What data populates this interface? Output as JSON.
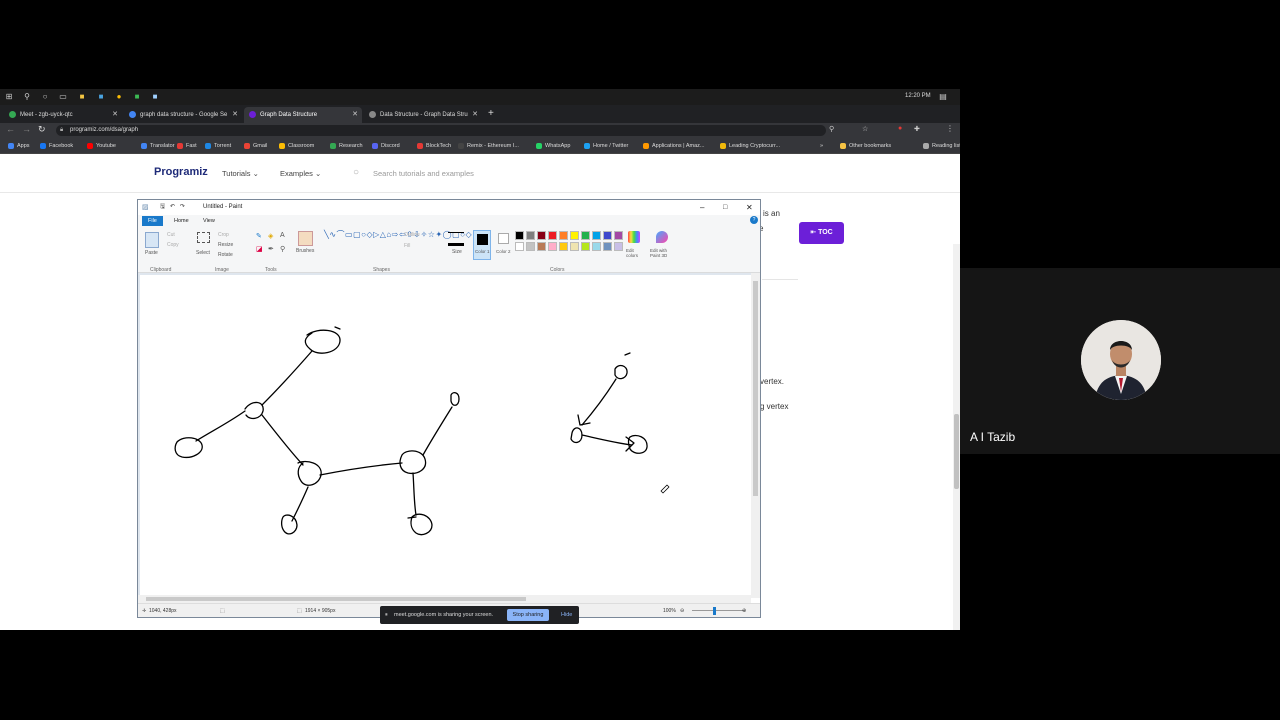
{
  "taskbar": {
    "time": "12:20 PM"
  },
  "tabs": [
    {
      "title": "Meet - zgb-uyck-qtc",
      "favicon": "#34a853"
    },
    {
      "title": "graph data structure - Google Se",
      "favicon": "#4285f4"
    },
    {
      "title": "Graph Data Structure",
      "favicon": "#6c1fd8"
    },
    {
      "title": "Data Structure - Graph Data Stru",
      "favicon": "#888888"
    }
  ],
  "address": {
    "url": "programiz.com/dsa/graph"
  },
  "bookmarks": [
    {
      "label": "Apps",
      "color": "#4285f4"
    },
    {
      "label": "Facebook",
      "color": "#1877f2"
    },
    {
      "label": "Youtube",
      "color": "#ff0000"
    },
    {
      "label": "Translator",
      "color": "#4285f4"
    },
    {
      "label": "Fast",
      "color": "#e53935"
    },
    {
      "label": "Torrent",
      "color": "#1e88e5"
    },
    {
      "label": "Gmail",
      "color": "#ea4335"
    },
    {
      "label": "Classroom",
      "color": "#fbbc04"
    },
    {
      "label": "Research",
      "color": "#34a853"
    },
    {
      "label": "Discord",
      "color": "#5865f2"
    },
    {
      "label": "BlockTech",
      "color": "#e53935"
    },
    {
      "label": "Remix - Ethereum I...",
      "color": "#444444"
    },
    {
      "label": "WhatsApp",
      "color": "#25d366"
    },
    {
      "label": "Home / Twitter",
      "color": "#1da1f2"
    },
    {
      "label": "Applications | Amaz...",
      "color": "#ff9900"
    },
    {
      "label": "Leading Cryptocurr...",
      "color": "#f0b90b"
    },
    {
      "label": "Other bookmarks",
      "color": "#f6c344"
    },
    {
      "label": "Reading list",
      "color": "#aaaaaa"
    }
  ],
  "site": {
    "logo": "Programiz",
    "nav_tutorials": "Tutorials",
    "nav_examples": "Examples",
    "search_placeholder": "Search tutorials and examples",
    "toc_label": "TOC",
    "text_1": "is an",
    "text_2": "e",
    "text_3": "vertex.",
    "text_4": "g vertex"
  },
  "paint": {
    "title": "Untitled - Paint",
    "tab_file": "File",
    "tab_home": "Home",
    "tab_view": "View",
    "paste": "Paste",
    "cut": "Cut",
    "copy": "Copy",
    "select": "Select",
    "crop": "Crop",
    "resize": "Resize",
    "rotate": "Rotate",
    "brushes": "Brushes",
    "outline": "Outline",
    "fill": "Fill",
    "size": "Size",
    "color1": "Color 1",
    "color2": "Color 2",
    "edit_colors": "Edit colors",
    "edit_paint3d": "Edit with Paint 3D",
    "group_clipboard": "Clipboard",
    "group_image": "Image",
    "group_tools": "Tools",
    "group_shapes": "Shapes",
    "group_colors": "Colors",
    "palette": [
      "#000000",
      "#7f7f7f",
      "#880015",
      "#ed1c24",
      "#ff7f27",
      "#fff200",
      "#22b14c",
      "#00a2e8",
      "#3f48cc",
      "#a349a4",
      "#ffffff",
      "#c3c3c3",
      "#b97a57",
      "#ffaec9",
      "#ffc90e",
      "#efe4b0",
      "#b5e61d",
      "#99d9ea",
      "#7092be",
      "#c8bfe7"
    ],
    "status_cursor": "1040, 428px",
    "status_size": "1914 × 905px",
    "zoom": "100%"
  },
  "share": {
    "message": "meet.google.com is sharing your screen.",
    "stop": "Stop sharing",
    "hide": "Hide"
  },
  "participant": {
    "name": "A I Tazib"
  }
}
